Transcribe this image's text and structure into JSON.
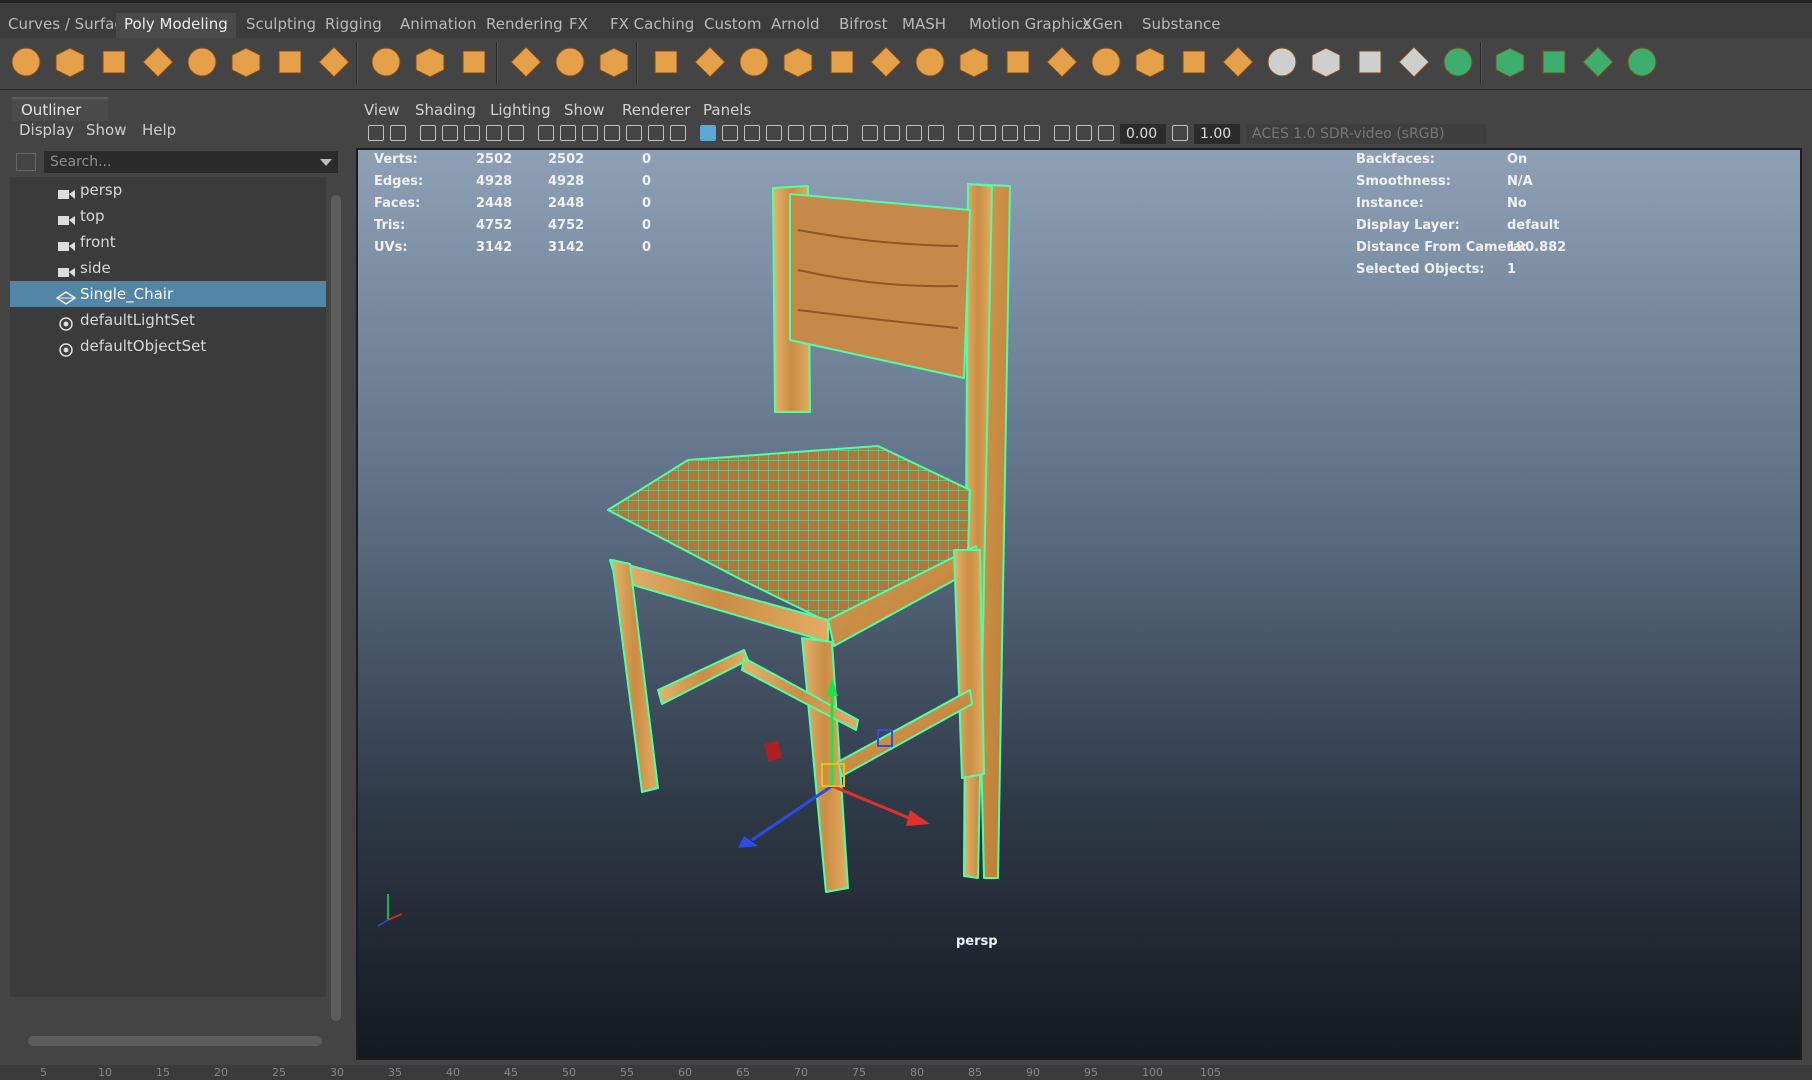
{
  "shelf_tabs": [
    "Curves / Surfaces",
    "Poly Modeling",
    "Sculpting",
    "Rigging",
    "Animation",
    "Rendering",
    "FX",
    "FX Caching",
    "Custom",
    "Arnold",
    "Bifrost",
    "MASH",
    "Motion Graphics",
    "XGen",
    "Substance"
  ],
  "active_tab": "Poly Modeling",
  "shelf_icons": [
    "sphere-icon",
    "cube-icon",
    "cylinder-icon",
    "cone-icon",
    "torus-icon",
    "plane-icon",
    "disc-icon",
    "platonic-icon",
    "super-shape-icon",
    "type-icon",
    "svg-icon",
    "sweep-mesh-icon",
    "helix-icon",
    "snowflake-icon",
    "combine-icon",
    "separate-icon",
    "mirror-icon",
    "smooth-icon",
    "bridge-icon",
    "extrude-icon",
    "bevel-icon",
    "multi-cut-icon",
    "target-weld-icon",
    "connect-icon",
    "insert-edge-loop-icon",
    "offset-edge-loop-icon",
    "fill-hole-icon",
    "merge-icon",
    "chamfer-icon",
    "poke-icon",
    "quad-draw-icon",
    "sculpt-icon",
    "uv-editor-icon",
    "planar-map-icon",
    "automatic-map-icon",
    "cylindrical-map-icon",
    "spherical-map-icon"
  ],
  "outliner": {
    "title": "Outliner",
    "menu": [
      "Display",
      "Show",
      "Help"
    ],
    "search_placeholder": "Search...",
    "items": [
      {
        "label": "persp",
        "icon": "camera-icon",
        "selected": false
      },
      {
        "label": "top",
        "icon": "camera-icon",
        "selected": false
      },
      {
        "label": "front",
        "icon": "camera-icon",
        "selected": false
      },
      {
        "label": "side",
        "icon": "camera-icon",
        "selected": false
      },
      {
        "label": "Single_Chair",
        "icon": "mesh-icon",
        "selected": true
      },
      {
        "label": "defaultLightSet",
        "icon": "set-icon",
        "selected": false
      },
      {
        "label": "defaultObjectSet",
        "icon": "set-icon",
        "selected": false
      }
    ]
  },
  "panel_menu": [
    "View",
    "Shading",
    "Lighting",
    "Show",
    "Renderer",
    "Panels"
  ],
  "viewport": {
    "camera": "persp",
    "exposure": "0.00",
    "gamma": "1.00",
    "color_space": "ACES 1.0 SDR-video (sRGB)"
  },
  "hud_left": [
    {
      "label": "Verts:",
      "a": "2502",
      "b": "2502",
      "c": "0"
    },
    {
      "label": "Edges:",
      "a": "4928",
      "b": "4928",
      "c": "0"
    },
    {
      "label": "Faces:",
      "a": "2448",
      "b": "2448",
      "c": "0"
    },
    {
      "label": "Tris:",
      "a": "4752",
      "b": "4752",
      "c": "0"
    },
    {
      "label": "UVs:",
      "a": "3142",
      "b": "3142",
      "c": "0"
    }
  ],
  "hud_right": [
    {
      "label": "Backfaces:",
      "value": "On"
    },
    {
      "label": "Smoothness:",
      "value": "N/A"
    },
    {
      "label": "Instance:",
      "value": "No"
    },
    {
      "label": "Display Layer:",
      "value": "default"
    },
    {
      "label": "Distance From Camera:",
      "value": "190.882"
    },
    {
      "label": "Selected Objects:",
      "value": "1"
    }
  ],
  "colors": {
    "selection": "#5285a6",
    "wireframe": "#4fffa8",
    "wood": "#d7a45c",
    "shelf_icon": "#e6a04a"
  },
  "timeline_ticks": [
    "5",
    "10",
    "15",
    "20",
    "25",
    "30",
    "35",
    "40",
    "45",
    "50",
    "55",
    "60",
    "65",
    "70",
    "75",
    "80",
    "85",
    "90",
    "95",
    "100",
    "105"
  ]
}
